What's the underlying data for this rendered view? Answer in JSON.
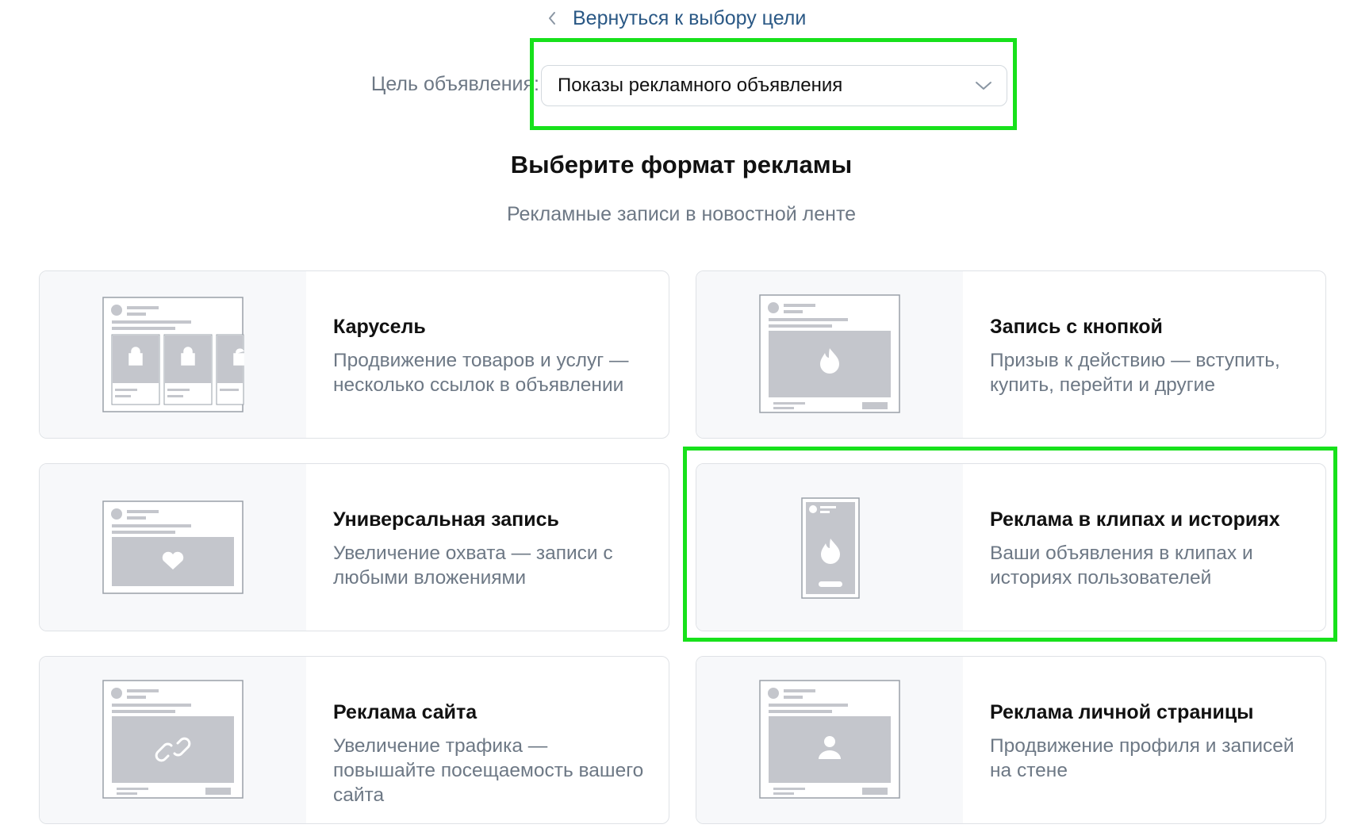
{
  "back_link": {
    "label": "Вернуться к выбору цели"
  },
  "goal": {
    "label": "Цель объявления:",
    "value": "Показы рекламного объявления"
  },
  "heading": "Выберите формат рекламы",
  "subheading": "Рекламные записи в новостной ленте",
  "formats": [
    {
      "title": "Карусель",
      "desc": "Продвижение товаров и услуг — несколько ссылок в объявлении",
      "icon": "carousel-icon"
    },
    {
      "title": "Запись с кнопкой",
      "desc": "Призыв к действию — вступить, купить, перейти и другие",
      "icon": "button-post-icon"
    },
    {
      "title": "Универсальная запись",
      "desc": "Увеличение охвата — записи с любыми вложениями",
      "icon": "universal-post-icon"
    },
    {
      "title": "Реклама в клипах и историях",
      "desc": "Ваши объявления в клипах и историях пользователей",
      "icon": "stories-icon"
    },
    {
      "title": "Реклама сайта",
      "desc": "Увеличение трафика — повышайте посещаемость вашего сайта",
      "icon": "website-icon"
    },
    {
      "title": "Реклама личной страницы",
      "desc": "Продвижение профиля и записей на стене",
      "icon": "profile-icon"
    }
  ],
  "colors": {
    "highlight": "#17e11b",
    "link": "#2a5885",
    "muted": "#6d7885",
    "placeholder": "#c4c6cc"
  }
}
